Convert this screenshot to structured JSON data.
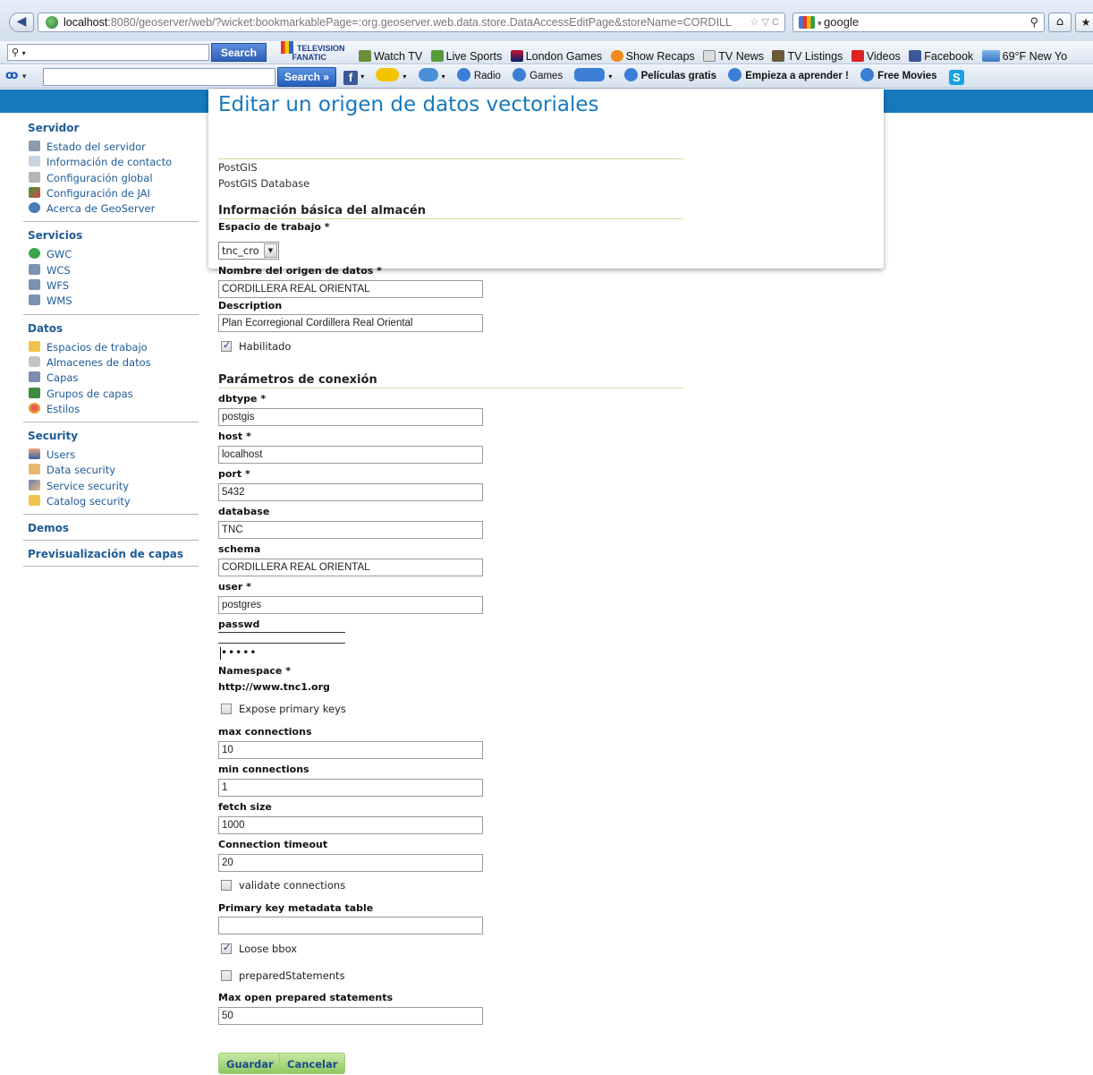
{
  "browser": {
    "url_host": "localhost",
    "url_rest": ":8080/geoserver/web/?wicket:bookmarkablePage=:org.geoserver.web.data.store.DataAccessEditPage&storeName=CORDILL",
    "search_query": "google"
  },
  "toolbar1": {
    "search_button": "Search",
    "links": [
      "Watch TV",
      "Live Sports",
      "London Games",
      "Show Recaps",
      "TV News",
      "TV Listings",
      "Videos",
      "Facebook",
      "69°F New Yo"
    ]
  },
  "toolbar2": {
    "search_button": "Search »",
    "links": [
      "Radio",
      "Games",
      "Películas gratis",
      "Empieza a aprender !",
      "Free Movies"
    ]
  },
  "page": {
    "title": "Editar un origen de datos vectoriales",
    "store_type": "PostGIS",
    "store_desc": "PostGIS Database"
  },
  "sidebar": {
    "sections": [
      {
        "title": "Servidor",
        "items": [
          "Estado del servidor",
          "Información de contacto",
          "Configuración global",
          "Configuración de JAI",
          "Acerca de GeoServer"
        ]
      },
      {
        "title": "Servicios",
        "items": [
          "GWC",
          "WCS",
          "WFS",
          "WMS"
        ]
      },
      {
        "title": "Datos",
        "items": [
          "Espacios de trabajo",
          "Almacenes de datos",
          "Capas",
          "Grupos de capas",
          "Estilos"
        ]
      },
      {
        "title": "Security",
        "items": [
          "Users",
          "Data security",
          "Service security",
          "Catalog security"
        ]
      },
      {
        "title": "Demos",
        "items": []
      },
      {
        "title": "Previsualización de capas",
        "items": []
      }
    ]
  },
  "basic": {
    "heading": "Información básica del almacén",
    "workspace_label": "Espacio de trabajo *",
    "workspace_value": "tnc_cro",
    "name_label": "Nombre del origen de datos *",
    "name_value": "CORDILLERA REAL ORIENTAL",
    "description_label": "Description",
    "description_value": "Plan Ecorregional Cordillera Real Oriental",
    "enabled_label": "Habilitado"
  },
  "conn": {
    "heading": "Parámetros de conexión",
    "dbtype_label": "dbtype *",
    "dbtype_value": "postgis",
    "host_label": "host *",
    "host_value": "localhost",
    "port_label": "port *",
    "port_value": "5432",
    "database_label": "database",
    "database_value": "TNC",
    "schema_label": "schema",
    "schema_value": "CORDILLERA REAL ORIENTAL",
    "user_label": "user *",
    "user_value": "postgres",
    "passwd_label": "passwd",
    "passwd_value": "•••••",
    "namespace_label": "Namespace *",
    "namespace_value": "http://www.tnc1.org",
    "expose_pk_label": "Expose primary keys",
    "max_conn_label": "max connections",
    "max_conn_value": "10",
    "min_conn_label": "min connections",
    "min_conn_value": "1",
    "fetch_label": "fetch size",
    "fetch_value": "1000",
    "timeout_label": "Connection timeout",
    "timeout_value": "20",
    "validate_label": "validate connections",
    "pk_table_label": "Primary key metadata table",
    "pk_table_value": "",
    "loose_bbox_label": "Loose bbox",
    "prepared_label": "preparedStatements",
    "max_prepared_label": "Max open prepared statements",
    "max_prepared_value": "50"
  },
  "buttons": {
    "save": "Guardar",
    "cancel": "Cancelar"
  }
}
